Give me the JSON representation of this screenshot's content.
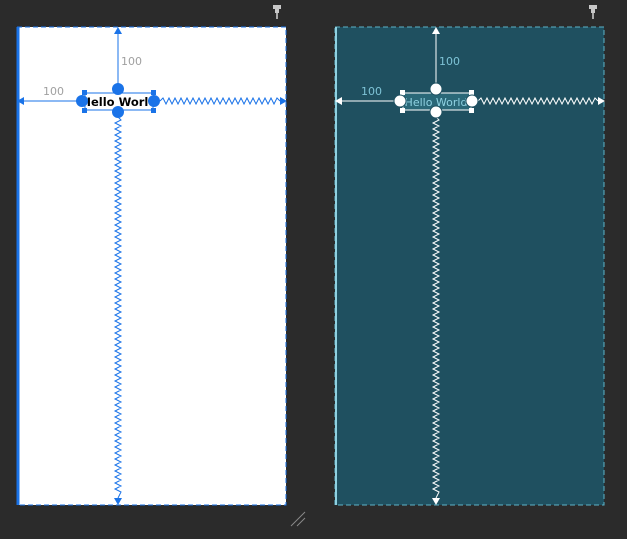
{
  "editor": {
    "colors": {
      "background": "#2b2b2b",
      "design_surface": "#ffffff",
      "blueprint_surface": "#1f5060",
      "constraint_blue": "#1a73e8",
      "blueprint_line": "#ffffff",
      "blueprint_text": "#7ec3d6",
      "margin_text": "#a0a0a0"
    },
    "icons": {
      "pin": "pin-icon",
      "resize": "resize-handle-icon"
    }
  },
  "design_view": {
    "widget_text": "Hello World",
    "top_margin": "100",
    "left_margin": "100"
  },
  "blueprint_view": {
    "widget_text": "Hello World",
    "top_margin": "100",
    "left_margin": "100"
  }
}
